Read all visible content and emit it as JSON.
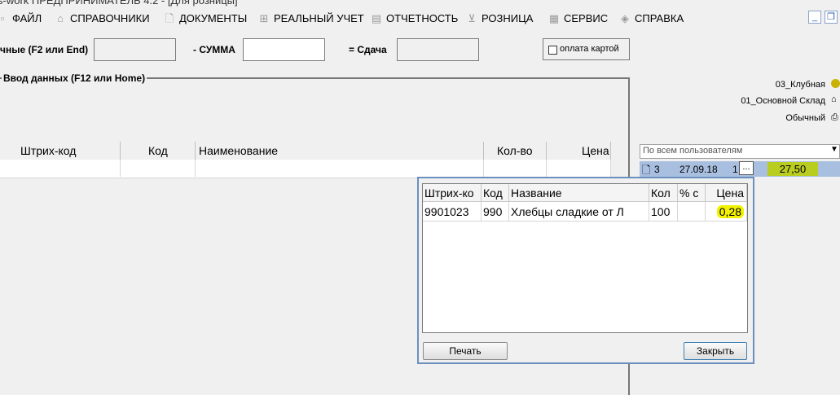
{
  "window": {
    "title": "s-work ПРЕДПРИНИМАТЕЛЬ 4.2 - [Для розницы]"
  },
  "menu": [
    {
      "label": "ФАЙЛ",
      "icon": "file-menu-icon"
    },
    {
      "label": "СПРАВОЧНИКИ",
      "icon": "home-icon"
    },
    {
      "label": "ДОКУМЕНТЫ",
      "icon": "document-icon"
    },
    {
      "label": "РЕАЛЬНЫЙ УЧЕТ",
      "icon": "plus-box-icon"
    },
    {
      "label": "ОТЧЕТНОСТЬ",
      "icon": "report-icon"
    },
    {
      "label": "РОЗНИЦА",
      "icon": "cart-icon"
    },
    {
      "label": "СЕРВИС",
      "icon": "service-icon"
    },
    {
      "label": "СПРАВКА",
      "icon": "help-icon"
    }
  ],
  "payment": {
    "cash_label": "чные (F2 или End)",
    "sum_label": "- СУММА",
    "change_label": "= Сдача",
    "card_label": "оплата картой"
  },
  "entry": {
    "legend": "Ввод данных (F12 или Home)"
  },
  "grid": {
    "columns": [
      "Штрих-код",
      "Код",
      "Наименование",
      "Кол-во",
      "Цена"
    ]
  },
  "right_panel": {
    "price_type": "03_Клубная",
    "warehouse": "01_Основной Склад",
    "check_type": "Обычный",
    "user_filter": "По всем пользователям",
    "doc": {
      "number": "3",
      "date": "27.09.18",
      "extra": "1",
      "ellipsis": "...",
      "total": "27,50"
    }
  },
  "popup": {
    "columns": [
      "Штрих-ко",
      "Код",
      "Название",
      "Кол",
      "% с",
      "Цена"
    ],
    "rows": [
      {
        "barcode": "9901023",
        "code": "990",
        "name": "Хлебцы сладкие  от Л",
        "qty": "100",
        "pct": "",
        "price": "0,28"
      }
    ],
    "print_label": "Печать",
    "close_label": "Закрыть"
  },
  "colors": {
    "highlight_yellow": "#f2f200",
    "highlight_green": "#b9cc20",
    "selected_row": "#a8bfe0",
    "popup_border": "#6b8fbf"
  }
}
